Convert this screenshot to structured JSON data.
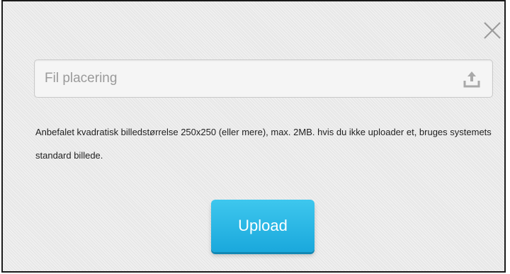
{
  "dialog": {
    "close_icon": "close-icon",
    "file_input": {
      "placeholder": "Fil placering",
      "value": "",
      "icon": "upload-icon"
    },
    "help_text": "Anbefalet kvadratisk billedstørrelse 250x250 (eller mere), max. 2MB. hvis du ikke uploader et, bruges systemets standard billede.",
    "upload_button_label": "Upload"
  },
  "colors": {
    "accent": "#1fb3e4",
    "dialog_background": "#ececec"
  }
}
